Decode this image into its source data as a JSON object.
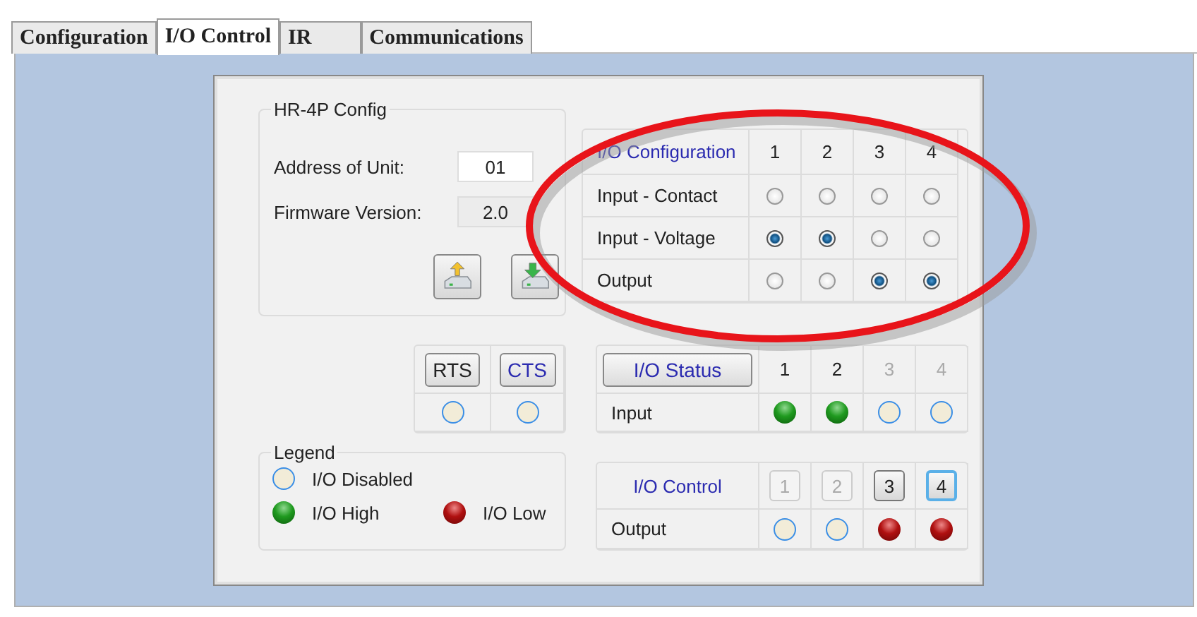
{
  "tabs": [
    {
      "label": "Configuration",
      "selected": false
    },
    {
      "label": "I/O Control",
      "selected": true
    },
    {
      "label": "IR",
      "selected": false
    },
    {
      "label": "Communications",
      "selected": false
    }
  ],
  "config": {
    "title": "HR-4P Config",
    "address_label": "Address of Unit:",
    "address_value": "01",
    "firmware_label": "Firmware Version:",
    "firmware_value": "2.0"
  },
  "io_configuration": {
    "header": "I/O Configuration",
    "columns": [
      "1",
      "2",
      "3",
      "4"
    ],
    "rows": [
      {
        "label": "Input - Contact",
        "options": [
          {
            "selected": false
          },
          {
            "selected": false
          },
          {
            "selected": false
          },
          {
            "selected": false
          }
        ]
      },
      {
        "label": "Input - Voltage",
        "options": [
          {
            "selected": true
          },
          {
            "selected": true
          },
          {
            "selected": false
          },
          {
            "selected": false
          }
        ]
      },
      {
        "label": "Output",
        "options": [
          {
            "selected": false
          },
          {
            "selected": false
          },
          {
            "selected": true
          },
          {
            "selected": true
          }
        ]
      }
    ]
  },
  "handshake": [
    {
      "label": "RTS",
      "kind": "disabled"
    },
    {
      "label": "CTS",
      "kind": "disabled"
    }
  ],
  "io_status": {
    "button": "I/O Status",
    "columns": [
      {
        "label": "1",
        "disabled": false
      },
      {
        "label": "2",
        "disabled": false
      },
      {
        "label": "3",
        "disabled": true
      },
      {
        "label": "4",
        "disabled": true
      }
    ],
    "row_label": "Input",
    "leds": [
      {
        "kind": "high"
      },
      {
        "kind": "high"
      },
      {
        "kind": "disabled"
      },
      {
        "kind": "disabled"
      }
    ]
  },
  "legend": {
    "title": "Legend",
    "items": [
      {
        "label": "I/O Disabled",
        "kind": "disabled"
      },
      {
        "label": "I/O High",
        "kind": "high"
      },
      {
        "label": "I/O Low",
        "kind": "low"
      }
    ]
  },
  "io_control": {
    "header": "I/O Control",
    "buttons": [
      {
        "label": "1",
        "disabled": true,
        "focused": false
      },
      {
        "label": "2",
        "disabled": true,
        "focused": false
      },
      {
        "label": "3",
        "disabled": false,
        "focused": false
      },
      {
        "label": "4",
        "disabled": false,
        "focused": true
      }
    ],
    "row_label": "Output",
    "leds": [
      {
        "kind": "disabled"
      },
      {
        "kind": "disabled"
      },
      {
        "kind": "low"
      },
      {
        "kind": "low"
      }
    ]
  }
}
